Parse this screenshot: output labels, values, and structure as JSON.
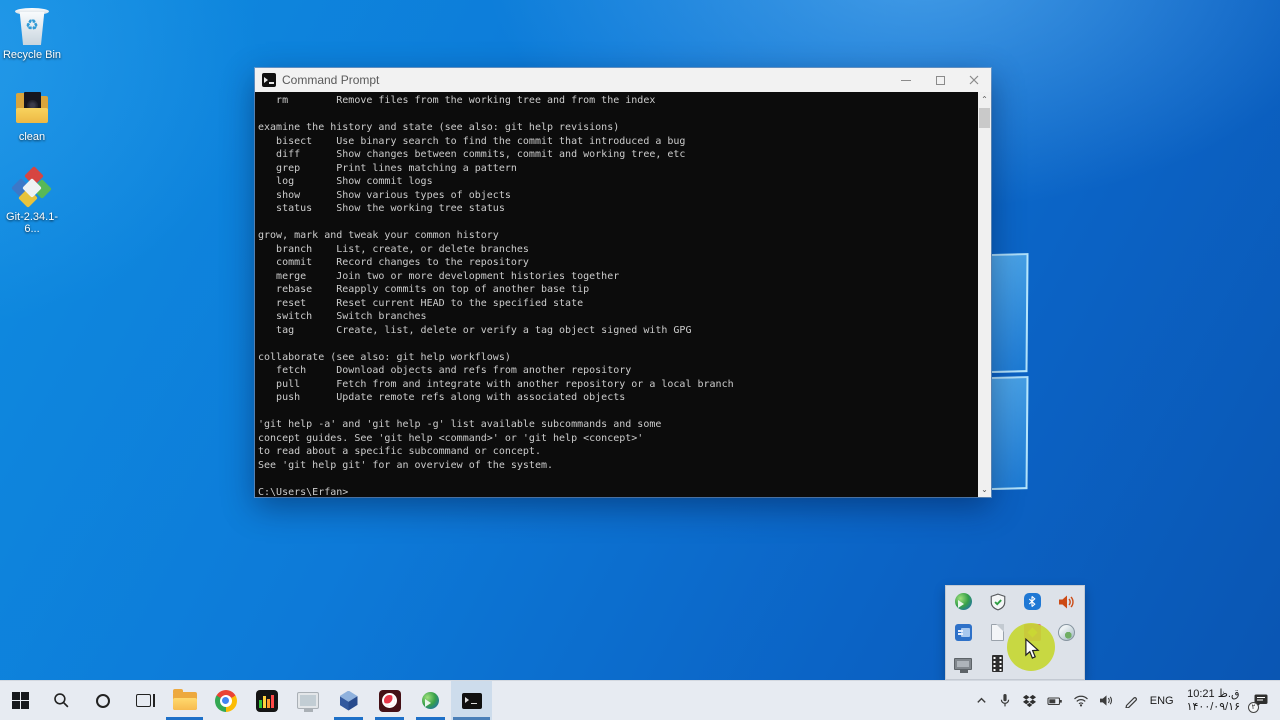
{
  "window": {
    "title": "Command Prompt",
    "console_lines": [
      "   rm        Remove files from the working tree and from the index",
      "",
      "examine the history and state (see also: git help revisions)",
      "   bisect    Use binary search to find the commit that introduced a bug",
      "   diff      Show changes between commits, commit and working tree, etc",
      "   grep      Print lines matching a pattern",
      "   log       Show commit logs",
      "   show      Show various types of objects",
      "   status    Show the working tree status",
      "",
      "grow, mark and tweak your common history",
      "   branch    List, create, or delete branches",
      "   commit    Record changes to the repository",
      "   merge     Join two or more development histories together",
      "   rebase    Reapply commits on top of another base tip",
      "   reset     Reset current HEAD to the specified state",
      "   switch    Switch branches",
      "   tag       Create, list, delete or verify a tag object signed with GPG",
      "",
      "collaborate (see also: git help workflows)",
      "   fetch     Download objects and refs from another repository",
      "   pull      Fetch from and integrate with another repository or a local branch",
      "   push      Update remote refs along with associated objects",
      "",
      "'git help -a' and 'git help -g' list available subcommands and some",
      "concept guides. See 'git help <command>' or 'git help <concept>'",
      "to read about a specific subcommand or concept.",
      "See 'git help git' for an overview of the system.",
      "",
      "C:\\Users\\Erfan>"
    ]
  },
  "desktop_icons": [
    {
      "label": "Recycle Bin"
    },
    {
      "label": "clean"
    },
    {
      "label": "Git-2.34.1-6..."
    }
  ],
  "taskbar": {
    "app_icon_names": [
      "start",
      "search",
      "cortana",
      "task-view",
      "file-explorer",
      "chrome",
      "equalizer-app",
      "system-monitor-app",
      "virtualbox",
      "camtasia",
      "idm",
      "command-prompt"
    ],
    "tray": {
      "icon_names": [
        "hidden-icons-chevron",
        "microphone",
        "dropbox",
        "battery",
        "wifi",
        "volume",
        "pen",
        "language",
        "clock",
        "action-center"
      ],
      "language": "ENG",
      "time": "10:21 ق.ظ",
      "date": "۱۴۰۰/۰۹/۱۶",
      "notification_badge": "۲"
    }
  },
  "tray_popup": {
    "icon_names": [
      "idm",
      "windows-defender",
      "bluetooth",
      "volume",
      "display-settings",
      "document",
      "recorder-pink",
      "network-globe",
      "display",
      "filmstrip"
    ]
  },
  "colors": {
    "accent": "#1e70c8",
    "console_bg": "#0c0c0c",
    "console_text": "#cccccc",
    "taskbar_bg": "#e7ebf2",
    "highlight_circle": "#c6d733"
  }
}
